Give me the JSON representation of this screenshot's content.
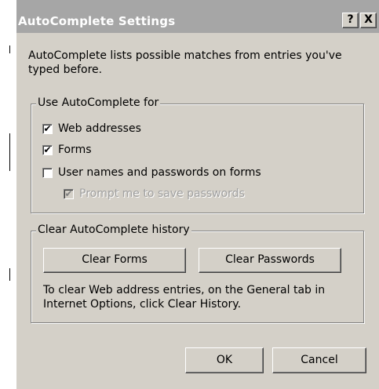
{
  "window": {
    "title": "AutoComplete Settings",
    "help_label": "?",
    "close_label": "X"
  },
  "description": {
    "line1": "AutoComplete lists possible matches from entries you've",
    "line2": "typed before."
  },
  "use_group": {
    "legend": "Use AutoComplete for",
    "items": [
      {
        "label": "Web addresses",
        "checked": true,
        "enabled": true
      },
      {
        "label": "Forms",
        "checked": true,
        "enabled": true
      },
      {
        "label": "User names and passwords on forms",
        "checked": false,
        "enabled": true
      },
      {
        "label": "Prompt me to save passwords",
        "checked": true,
        "enabled": false
      }
    ]
  },
  "history_group": {
    "legend": "Clear AutoComplete history",
    "clear_forms_label": "Clear Forms",
    "clear_passwords_label": "Clear Passwords",
    "note_line1": "To clear Web address entries, on the General tab in",
    "note_line2": "Internet Options, click Clear History."
  },
  "buttons": {
    "ok_label": "OK",
    "cancel_label": "Cancel"
  },
  "colors": {
    "titlebar_inactive": "#a6a6a6",
    "dialog_face": "#d4d0c8",
    "disabled_text": "#a0a0a0"
  }
}
